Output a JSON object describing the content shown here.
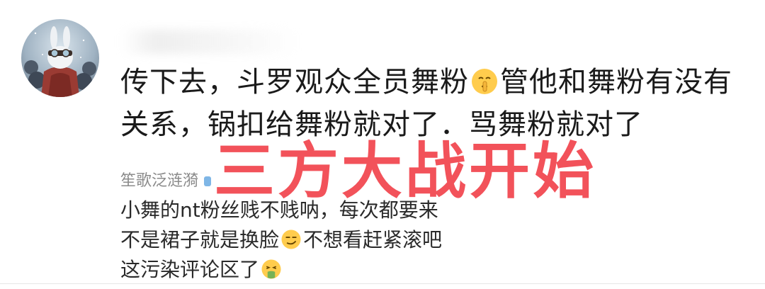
{
  "comment": {
    "avatar_icon": "bunny-avatar-icon",
    "main_text": {
      "line1_part1": "传下去，斗罗观众全员舞粉",
      "line1_emoji": "shushing-face-emoji",
      "line1_part2": "管他和舞粉有没有",
      "line2": "关系，锅扣给舞粉就对了．骂舞粉就对了"
    }
  },
  "reply": {
    "author": "笙歌泛涟漪",
    "lines": {
      "line1": "小舞的nt粉丝贱不贱呐，每次都要来",
      "line2_part1": "不是裙子就是换脸",
      "line2_emoji": "smirk-emoji",
      "line2_part2": "不想看赶紧滚吧",
      "line3": "这污染评论区了",
      "line3_emoji": "vomit-emoji"
    }
  },
  "overlay": {
    "headline": "三方大战开始",
    "color": "#f2525a"
  }
}
